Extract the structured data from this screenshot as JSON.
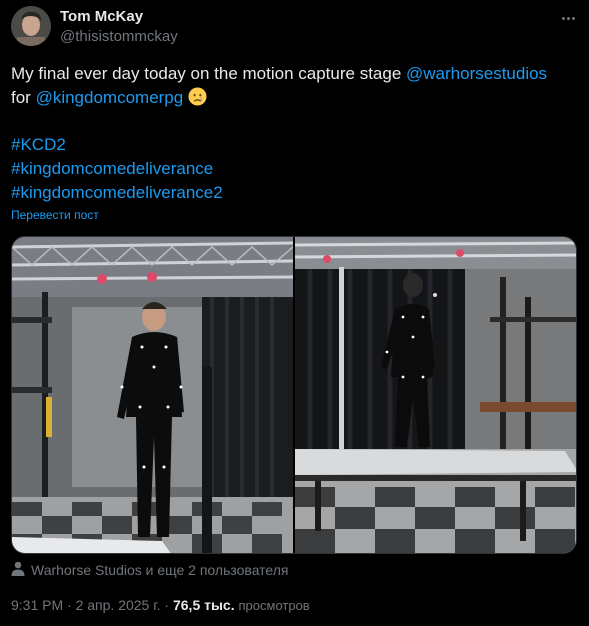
{
  "author": {
    "name": "Tom McKay",
    "handle": "@thisistommckay"
  },
  "tweet": {
    "text_before": "My final ever day today on the motion capture stage ",
    "mention_1": "@warhorsestudios",
    "text_middle": "for ",
    "mention_2": "@kingdomcomerpg",
    "emoji": "crying-face",
    "hashtags": [
      "#KCD2",
      "#kingdomcomedeliverance",
      "#kingdomcomedeliverance2"
    ],
    "translate_label": "Перевести пост"
  },
  "media": {
    "photos": [
      {
        "alt_icon": "photo-mocap-stage-left"
      },
      {
        "alt_icon": "photo-mocap-stage-right"
      }
    ]
  },
  "tagged": {
    "icon": "person-icon",
    "text": "Warhorse Studios и еще 2 пользователя"
  },
  "meta": {
    "time": "9:31 PM",
    "date": "2 апр. 2025 г.",
    "views_count": "76,5 тыс.",
    "views_label": "просмотров",
    "separator": "·"
  },
  "colors": {
    "link": "#1d9bf0",
    "secondary": "#71767b",
    "primary": "#e7e9ea",
    "background": "#000000"
  }
}
